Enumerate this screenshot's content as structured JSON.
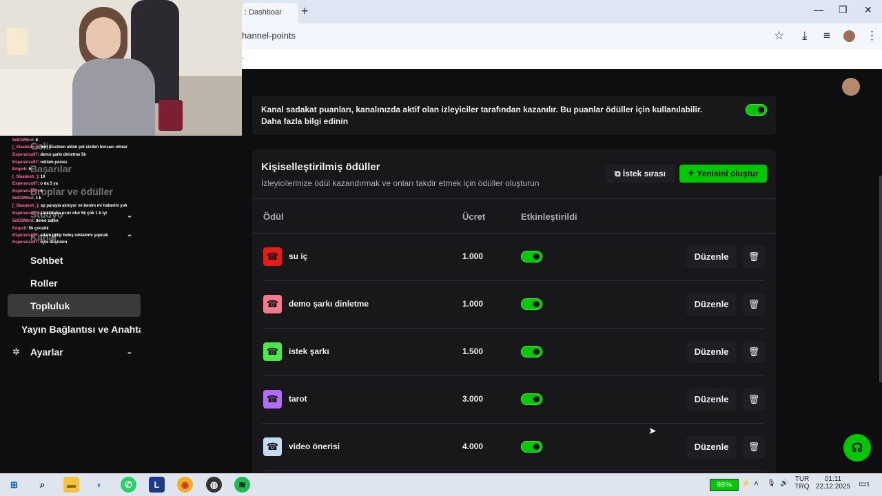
{
  "browser": {
    "tab_title": ": Dashboar",
    "new_tab": "+",
    "url": "hannel-points",
    "bookmark_dot": ".",
    "window_controls": {
      "minimize": "—",
      "maximize": "❐",
      "close": "✕"
    },
    "icons": [
      "star-icon",
      "download-icon",
      "media-icon",
      "profile-avatar",
      "kebab-menu-icon"
    ]
  },
  "chat_overlay": [
    {
      "user": "5nEl3Mbid",
      "msg": ": 8"
    },
    {
      "user": "[_Slaanesh_]",
      "msg": ": ben ucuzken aldım çet sizden borsacı olmaz"
    },
    {
      "user": "Esperanza97",
      "msg": ": demo şarkı dinletme 5k"
    },
    {
      "user": "Esperanza97",
      "msg": ": reklam parası"
    },
    {
      "user": "Empoli",
      "msg": ": 6"
    },
    {
      "user": "[_Slaanesh_]",
      "msg": ": 10"
    },
    {
      "user": "Esperanza97",
      "msg": ": o da 5 ya"
    },
    {
      "user": "Esperanza97",
      "msg": ": 4"
    },
    {
      "user": "5nEl3Mbid",
      "msg": ": 1 k"
    },
    {
      "user": "[_Slaanesh_]",
      "msg": ": sp parayla alınıyor ve benim mi haberim yok"
    },
    {
      "user": "Esperanza97",
      "msg": ": şarkı daha ucuz olur 5k çok 1 k iyi"
    },
    {
      "user": "5nEl3Mbid",
      "msg": ": demo zaten"
    },
    {
      "user": "Empoli",
      "msg": ": 5k çocukk"
    },
    {
      "user": "Esperanza97",
      "msg": ": adam gelip beleş reklamını yapcak"
    },
    {
      "user": "Esperanza97",
      "msg": ": öyle düşünün"
    }
  ],
  "sidebar": {
    "items": [
      {
        "label": "Gelir"
      },
      {
        "label": "Başarılar"
      },
      {
        "label": "Droplar ve ödüller"
      },
      {
        "label": "Stüdyo"
      },
      {
        "label": "Kanal"
      },
      {
        "label": "Sohbet"
      },
      {
        "label": "Roller"
      },
      {
        "label": "Topluluk"
      },
      {
        "label": "Yayın Bağlantısı ve Anahtarı"
      },
      {
        "label": "Ayarlar"
      }
    ]
  },
  "info": {
    "line1": "Kanal sadakat puanları, kanalınızda aktif olan izleyiciler tarafından kazanılır. Bu puanlar ödüller için kullanılabilir.",
    "line2": "Daha fazla bilgi edinin"
  },
  "rewards": {
    "title": "Kişiselleştirilmiş ödüller",
    "subtitle": "İzleyicilerinize ödül kazandırmak ve onları takdir etmek için ödüller oluşturun",
    "queue_button": "İstek sırası",
    "new_button": "Yenisini oluştur",
    "headers": {
      "reward": "Ödül",
      "cost": "Ücret",
      "enabled": "Etkinleştirildi"
    },
    "edit_label": "Düzenle",
    "items": [
      {
        "name": "su iç",
        "cost": "1.000",
        "color": "#e91916",
        "enabled": true
      },
      {
        "name": "demo şarkı dinletme",
        "cost": "1.000",
        "color": "#f27a8c",
        "enabled": true
      },
      {
        "name": "istek şarkı",
        "cost": "1.500",
        "color": "#4be84b",
        "enabled": true
      },
      {
        "name": "tarot",
        "cost": "3.000",
        "color": "#b36cf5",
        "enabled": true
      },
      {
        "name": "video önerisi",
        "cost": "4.000",
        "color": "#c3dcf2",
        "enabled": true
      }
    ]
  },
  "taskbar": {
    "battery": "98%",
    "lang_top": "TUR",
    "lang_bottom": "TRQ",
    "time": "01:11",
    "date": "22.12.2025",
    "notifications": "5"
  }
}
